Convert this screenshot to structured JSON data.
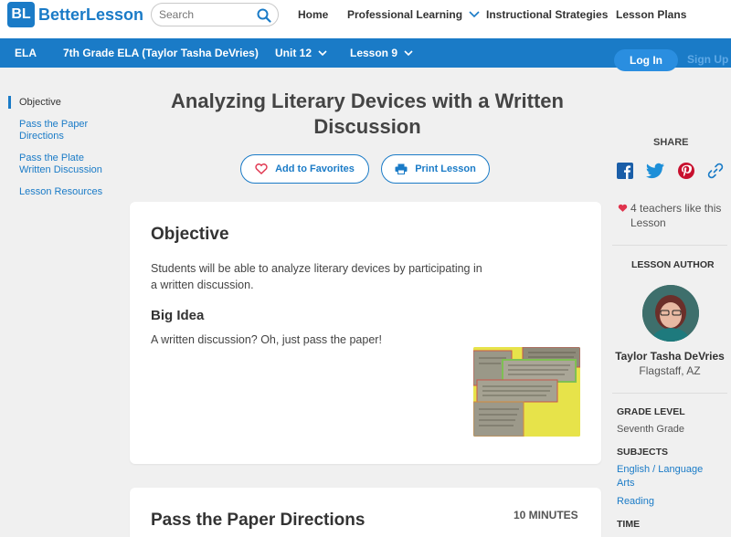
{
  "header": {
    "logo_mark": "BL",
    "logo_text": "BetterLesson",
    "search_placeholder": "Search",
    "nav": [
      "Home",
      "Professional Learning",
      "Instructional Strategies",
      "Lesson Plans"
    ]
  },
  "breadcrumb": {
    "items": [
      "ELA",
      "7th Grade ELA (Taylor Tasha DeVries)",
      "Unit 12",
      "Lesson 9"
    ],
    "login_label": "Log In",
    "signup_label": "Sign Up"
  },
  "leftnav": {
    "items": [
      "Objective",
      "Pass the Paper Directions",
      "Pass the Plate Written Discussion",
      "Lesson Resources"
    ],
    "active_index": 0
  },
  "lesson": {
    "title": "Analyzing Literary Devices with a Written Discussion",
    "favorite_label": "Add to Favorites",
    "print_label": "Print Lesson"
  },
  "objective": {
    "heading": "Objective",
    "text": "Students will be able to analyze literary devices by participating in a written discussion.",
    "big_idea_heading": "Big Idea",
    "big_idea_text": "A written discussion? Oh, just pass the paper!"
  },
  "section2": {
    "heading": "Pass the Paper Directions",
    "duration": "10 MINUTES"
  },
  "sidebar": {
    "share_label": "SHARE",
    "share_icons": [
      "facebook-icon",
      "twitter-icon",
      "pinterest-icon",
      "link-icon"
    ],
    "likes_text": "4 teachers like this Lesson",
    "author_heading": "LESSON AUTHOR",
    "author_name": "Taylor Tasha DeVries",
    "author_location": "Flagstaff, AZ",
    "grade_heading": "GRADE LEVEL",
    "grade_value": "Seventh Grade",
    "subjects_heading": "SUBJECTS",
    "subjects": [
      "English / Language Arts",
      "Reading"
    ],
    "time_heading": "TIME"
  },
  "colors": {
    "brand_blue": "#1a7bc7",
    "heart_red": "#e0334d",
    "page_bg": "#f0f0f0"
  }
}
